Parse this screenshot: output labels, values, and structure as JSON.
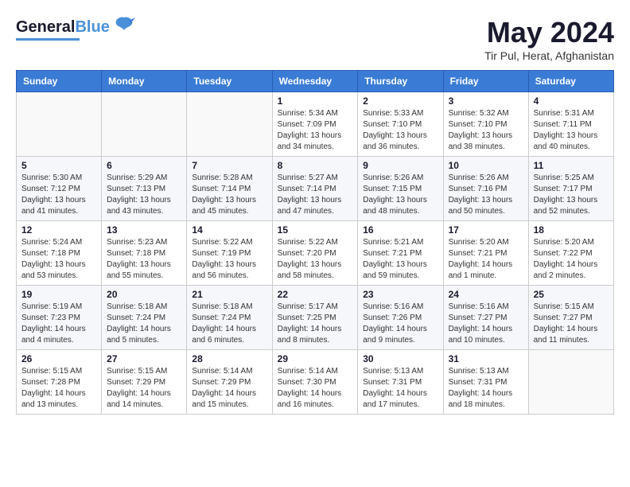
{
  "header": {
    "logo_general": "General",
    "logo_blue": "Blue",
    "month_year": "May 2024",
    "location": "Tir Pul, Herat, Afghanistan"
  },
  "weekdays": [
    "Sunday",
    "Monday",
    "Tuesday",
    "Wednesday",
    "Thursday",
    "Friday",
    "Saturday"
  ],
  "weeks": [
    [
      {
        "day": "",
        "info": ""
      },
      {
        "day": "",
        "info": ""
      },
      {
        "day": "",
        "info": ""
      },
      {
        "day": "1",
        "info": "Sunrise: 5:34 AM\nSunset: 7:09 PM\nDaylight: 13 hours\nand 34 minutes."
      },
      {
        "day": "2",
        "info": "Sunrise: 5:33 AM\nSunset: 7:10 PM\nDaylight: 13 hours\nand 36 minutes."
      },
      {
        "day": "3",
        "info": "Sunrise: 5:32 AM\nSunset: 7:10 PM\nDaylight: 13 hours\nand 38 minutes."
      },
      {
        "day": "4",
        "info": "Sunrise: 5:31 AM\nSunset: 7:11 PM\nDaylight: 13 hours\nand 40 minutes."
      }
    ],
    [
      {
        "day": "5",
        "info": "Sunrise: 5:30 AM\nSunset: 7:12 PM\nDaylight: 13 hours\nand 41 minutes."
      },
      {
        "day": "6",
        "info": "Sunrise: 5:29 AM\nSunset: 7:13 PM\nDaylight: 13 hours\nand 43 minutes."
      },
      {
        "day": "7",
        "info": "Sunrise: 5:28 AM\nSunset: 7:14 PM\nDaylight: 13 hours\nand 45 minutes."
      },
      {
        "day": "8",
        "info": "Sunrise: 5:27 AM\nSunset: 7:14 PM\nDaylight: 13 hours\nand 47 minutes."
      },
      {
        "day": "9",
        "info": "Sunrise: 5:26 AM\nSunset: 7:15 PM\nDaylight: 13 hours\nand 48 minutes."
      },
      {
        "day": "10",
        "info": "Sunrise: 5:26 AM\nSunset: 7:16 PM\nDaylight: 13 hours\nand 50 minutes."
      },
      {
        "day": "11",
        "info": "Sunrise: 5:25 AM\nSunset: 7:17 PM\nDaylight: 13 hours\nand 52 minutes."
      }
    ],
    [
      {
        "day": "12",
        "info": "Sunrise: 5:24 AM\nSunset: 7:18 PM\nDaylight: 13 hours\nand 53 minutes."
      },
      {
        "day": "13",
        "info": "Sunrise: 5:23 AM\nSunset: 7:18 PM\nDaylight: 13 hours\nand 55 minutes."
      },
      {
        "day": "14",
        "info": "Sunrise: 5:22 AM\nSunset: 7:19 PM\nDaylight: 13 hours\nand 56 minutes."
      },
      {
        "day": "15",
        "info": "Sunrise: 5:22 AM\nSunset: 7:20 PM\nDaylight: 13 hours\nand 58 minutes."
      },
      {
        "day": "16",
        "info": "Sunrise: 5:21 AM\nSunset: 7:21 PM\nDaylight: 13 hours\nand 59 minutes."
      },
      {
        "day": "17",
        "info": "Sunrise: 5:20 AM\nSunset: 7:21 PM\nDaylight: 14 hours\nand 1 minute."
      },
      {
        "day": "18",
        "info": "Sunrise: 5:20 AM\nSunset: 7:22 PM\nDaylight: 14 hours\nand 2 minutes."
      }
    ],
    [
      {
        "day": "19",
        "info": "Sunrise: 5:19 AM\nSunset: 7:23 PM\nDaylight: 14 hours\nand 4 minutes."
      },
      {
        "day": "20",
        "info": "Sunrise: 5:18 AM\nSunset: 7:24 PM\nDaylight: 14 hours\nand 5 minutes."
      },
      {
        "day": "21",
        "info": "Sunrise: 5:18 AM\nSunset: 7:24 PM\nDaylight: 14 hours\nand 6 minutes."
      },
      {
        "day": "22",
        "info": "Sunrise: 5:17 AM\nSunset: 7:25 PM\nDaylight: 14 hours\nand 8 minutes."
      },
      {
        "day": "23",
        "info": "Sunrise: 5:16 AM\nSunset: 7:26 PM\nDaylight: 14 hours\nand 9 minutes."
      },
      {
        "day": "24",
        "info": "Sunrise: 5:16 AM\nSunset: 7:27 PM\nDaylight: 14 hours\nand 10 minutes."
      },
      {
        "day": "25",
        "info": "Sunrise: 5:15 AM\nSunset: 7:27 PM\nDaylight: 14 hours\nand 11 minutes."
      }
    ],
    [
      {
        "day": "26",
        "info": "Sunrise: 5:15 AM\nSunset: 7:28 PM\nDaylight: 14 hours\nand 13 minutes."
      },
      {
        "day": "27",
        "info": "Sunrise: 5:15 AM\nSunset: 7:29 PM\nDaylight: 14 hours\nand 14 minutes."
      },
      {
        "day": "28",
        "info": "Sunrise: 5:14 AM\nSunset: 7:29 PM\nDaylight: 14 hours\nand 15 minutes."
      },
      {
        "day": "29",
        "info": "Sunrise: 5:14 AM\nSunset: 7:30 PM\nDaylight: 14 hours\nand 16 minutes."
      },
      {
        "day": "30",
        "info": "Sunrise: 5:13 AM\nSunset: 7:31 PM\nDaylight: 14 hours\nand 17 minutes."
      },
      {
        "day": "31",
        "info": "Sunrise: 5:13 AM\nSunset: 7:31 PM\nDaylight: 14 hours\nand 18 minutes."
      },
      {
        "day": "",
        "info": ""
      }
    ]
  ]
}
